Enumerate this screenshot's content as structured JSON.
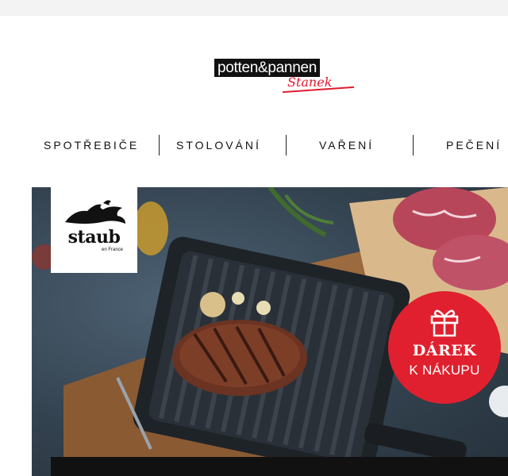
{
  "logo": {
    "brand_top": "potten&pannen",
    "brand_script": "Stanek"
  },
  "nav": {
    "items": [
      {
        "label": "SPOTŘEBIČE"
      },
      {
        "label": "STOLOVÁNÍ"
      },
      {
        "label": "VAŘENÍ"
      },
      {
        "label": "PEČENÍ"
      }
    ]
  },
  "hero": {
    "brand_logo": "staub",
    "brand_logo_sub": "en France",
    "badge": {
      "line1": "DÁREK",
      "line2": "K NÁKUPU",
      "icon": "gift-icon"
    }
  },
  "colors": {
    "accent_red": "#e0202e",
    "logo_black": "#111111"
  }
}
